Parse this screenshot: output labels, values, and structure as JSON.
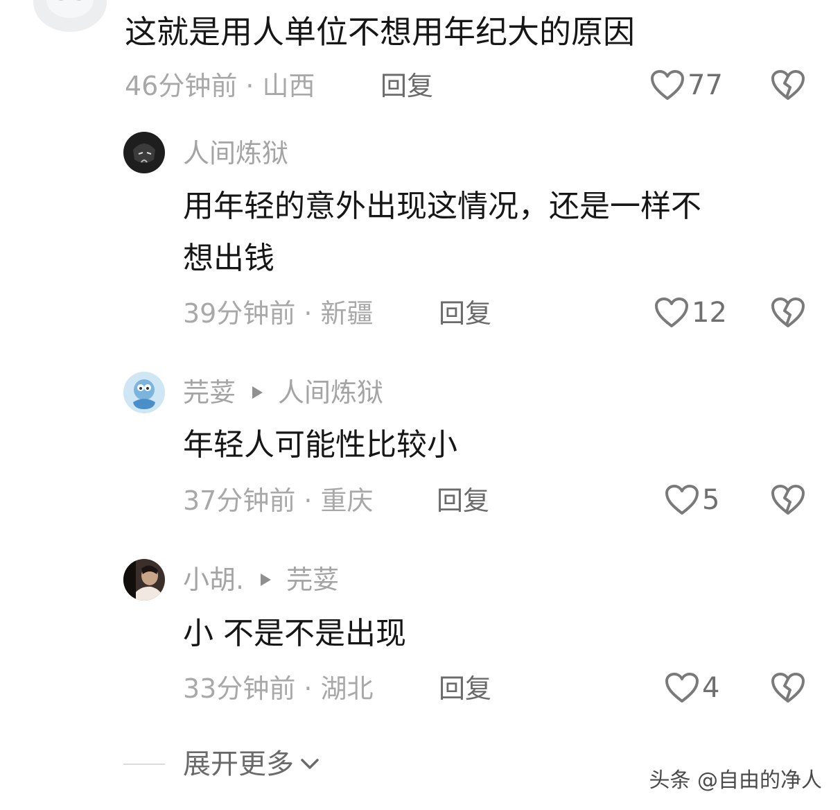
{
  "comments": [
    {
      "text": "这就是用人单位不想用年纪大的原因",
      "time": "46分钟前",
      "location": "山西",
      "reply_label": "回复",
      "likes": "77"
    },
    {
      "username": "人间炼狱",
      "text_line1": "用年轻的意外出现这情况，还是一样不",
      "text_line2": "想出钱",
      "time": "39分钟前",
      "location": "新疆",
      "reply_label": "回复",
      "likes": "12"
    },
    {
      "username": "芫荽",
      "reply_to": "人间炼狱",
      "text": "年轻人可能性比较小",
      "time": "37分钟前",
      "location": "重庆",
      "reply_label": "回复",
      "likes": "5"
    },
    {
      "username": "小胡.",
      "reply_to": "芫荽",
      "text": "小 不是不是出现",
      "time": "33分钟前",
      "location": "湖北",
      "reply_label": "回复",
      "likes": "4"
    }
  ],
  "separator": "·",
  "expand_label": "展开更多",
  "watermark": "头条 @自由的净人",
  "icons": {
    "like": "heart-outline-icon",
    "dislike": "broken-heart-icon",
    "expand": "chevron-down-icon"
  }
}
